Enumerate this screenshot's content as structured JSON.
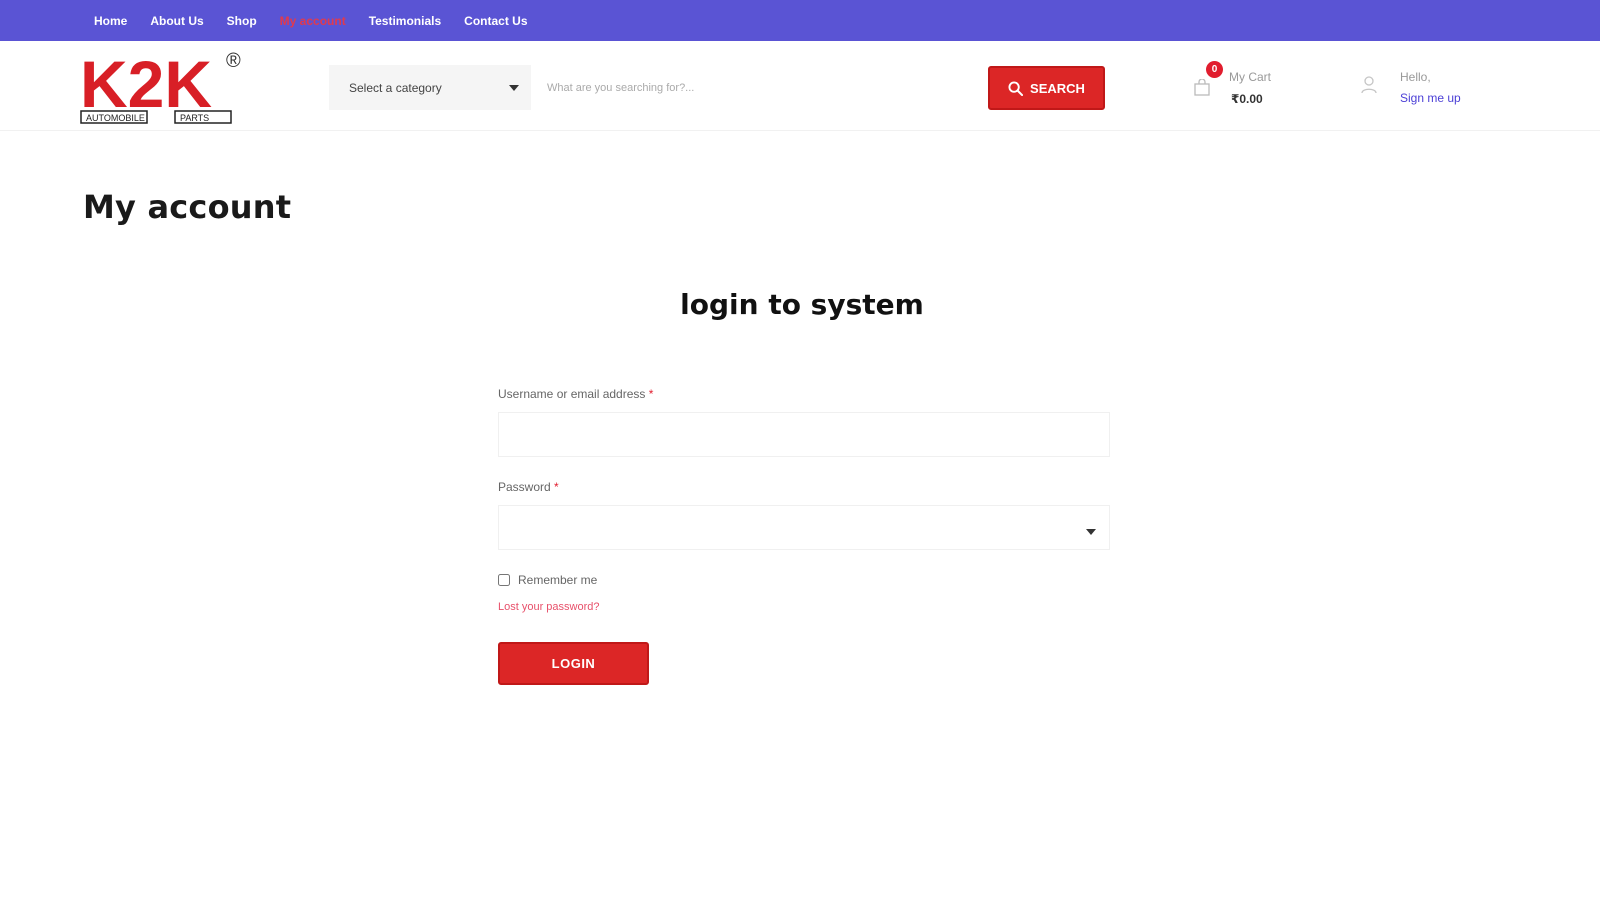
{
  "nav": {
    "items": [
      {
        "label": "Home",
        "active": false
      },
      {
        "label": "About Us",
        "active": false
      },
      {
        "label": "Shop",
        "active": false
      },
      {
        "label": "My account",
        "active": true
      },
      {
        "label": "Testimonials",
        "active": false
      },
      {
        "label": "Contact Us",
        "active": false
      }
    ]
  },
  "logo": {
    "text": "K2K",
    "left_caption": "AUTOMOBILE",
    "right_caption": "PARTS",
    "registered": "®"
  },
  "header": {
    "category_label": "Select a category",
    "search_placeholder": "What are you searching for?...",
    "search_button": "SEARCH",
    "cart": {
      "count": "0",
      "label": "My Cart",
      "amount": "₹0.00"
    },
    "user": {
      "greeting": "Hello,",
      "signup": "Sign me up"
    }
  },
  "page": {
    "title": "My account",
    "login_title": "login to system",
    "username_label": "Username or email address",
    "password_label": "Password",
    "required_mark": "*",
    "remember_label": "Remember me",
    "lost_password": "Lost your password?",
    "login_button": "LOGIN"
  },
  "colors": {
    "nav_bg": "#5a54d4",
    "nav_active": "#e03a4e",
    "accent_red": "#dc2626",
    "link_blue": "#4b3fd6"
  },
  "icons": {
    "search": "search-icon",
    "cart": "shopping-bag-icon",
    "user": "user-icon",
    "dropdown": "chevron-down-icon"
  }
}
